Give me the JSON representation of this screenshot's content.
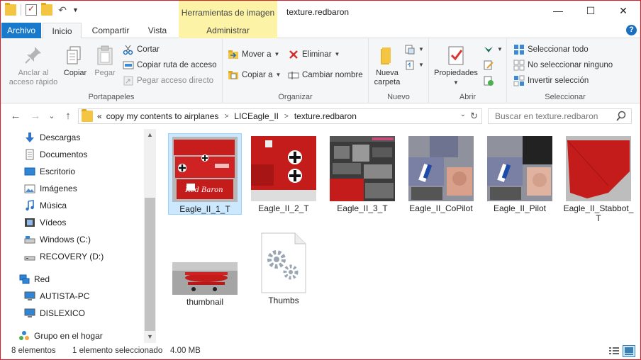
{
  "window": {
    "title": "texture.redbaron",
    "context_tab_header": "Herramientas de imagen",
    "minimize": "—",
    "maximize": "☐",
    "close": "✕"
  },
  "tabs": {
    "file": "Archivo",
    "home": "Inicio",
    "share": "Compartir",
    "view": "Vista",
    "manage": "Administrar",
    "expand": "⌃",
    "help": "?"
  },
  "ribbon": {
    "clipboard": {
      "label": "Portapapeles",
      "pin": "Anclar al acceso rápido",
      "copy": "Copiar",
      "paste": "Pegar",
      "cut": "Cortar",
      "copy_path": "Copiar ruta de acceso",
      "paste_shortcut": "Pegar acceso directo"
    },
    "organize": {
      "label": "Organizar",
      "move_to": "Mover a",
      "copy_to": "Copiar a",
      "delete": "Eliminar",
      "rename": "Cambiar nombre"
    },
    "new": {
      "label": "Nuevo",
      "new_folder": "Nueva carpeta"
    },
    "open": {
      "label": "Abrir",
      "properties": "Propiedades"
    },
    "select": {
      "label": "Seleccionar",
      "select_all": "Seleccionar todo",
      "select_none": "No seleccionar ninguno",
      "invert": "Invertir selección"
    }
  },
  "navigation": {
    "back": "←",
    "forward": "→",
    "recent": "⌄",
    "up": "↑",
    "breadcrumb": [
      "«",
      "copy my contents to airplanes",
      "LICEagle_II",
      "texture.redbaron"
    ],
    "search_placeholder": "Buscar en texture.redbaron"
  },
  "sidebar": {
    "items": [
      {
        "label": "Descargas",
        "icon": "download-icon"
      },
      {
        "label": "Documentos",
        "icon": "documents-icon"
      },
      {
        "label": "Escritorio",
        "icon": "desktop-icon"
      },
      {
        "label": "Imágenes",
        "icon": "pictures-icon"
      },
      {
        "label": "Música",
        "icon": "music-icon"
      },
      {
        "label": "Vídeos",
        "icon": "videos-icon"
      },
      {
        "label": "Windows (C:)",
        "icon": "drive-icon"
      },
      {
        "label": "RECOVERY (D:)",
        "icon": "drive-icon"
      },
      {
        "label": "Red",
        "icon": "network-icon"
      },
      {
        "label": "AUTISTA-PC",
        "icon": "computer-icon"
      },
      {
        "label": "DISLEXICO",
        "icon": "computer-icon"
      },
      {
        "label": "Grupo en el hogar",
        "icon": "homegroup-icon"
      }
    ]
  },
  "files": [
    {
      "name": "Eagle_II_1_T",
      "selected": true
    },
    {
      "name": "Eagle_II_2_T",
      "selected": false
    },
    {
      "name": "Eagle_II_3_T",
      "selected": false
    },
    {
      "name": "Eagle_II_CoPilot",
      "selected": false
    },
    {
      "name": "Eagle_II_Pilot",
      "selected": false
    },
    {
      "name": "Eagle_II_Stabbot_T",
      "selected": false
    },
    {
      "name": "thumbnail",
      "selected": false
    },
    {
      "name": "Thumbs",
      "selected": false
    }
  ],
  "thumb_texts": {
    "red_baron": "Red Baron"
  },
  "status": {
    "count": "8 elementos",
    "selection": "1 elemento seleccionado",
    "size": "4.00 MB"
  },
  "colors": {
    "accent": "#1979ca",
    "context_tab": "#fdf3a6",
    "selection": "#cce8ff",
    "window_border": "#d81e2a"
  }
}
